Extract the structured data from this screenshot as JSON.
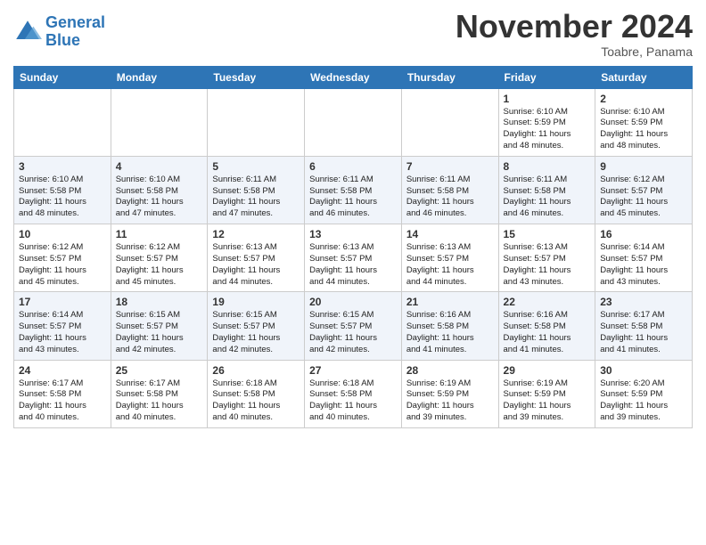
{
  "header": {
    "logo_line1": "General",
    "logo_line2": "Blue",
    "month_title": "November 2024",
    "location": "Toabre, Panama"
  },
  "weekdays": [
    "Sunday",
    "Monday",
    "Tuesday",
    "Wednesday",
    "Thursday",
    "Friday",
    "Saturday"
  ],
  "weeks": [
    [
      {
        "day": "",
        "info": ""
      },
      {
        "day": "",
        "info": ""
      },
      {
        "day": "",
        "info": ""
      },
      {
        "day": "",
        "info": ""
      },
      {
        "day": "",
        "info": ""
      },
      {
        "day": "1",
        "info": "Sunrise: 6:10 AM\nSunset: 5:59 PM\nDaylight: 11 hours\nand 48 minutes."
      },
      {
        "day": "2",
        "info": "Sunrise: 6:10 AM\nSunset: 5:59 PM\nDaylight: 11 hours\nand 48 minutes."
      }
    ],
    [
      {
        "day": "3",
        "info": "Sunrise: 6:10 AM\nSunset: 5:58 PM\nDaylight: 11 hours\nand 48 minutes."
      },
      {
        "day": "4",
        "info": "Sunrise: 6:10 AM\nSunset: 5:58 PM\nDaylight: 11 hours\nand 47 minutes."
      },
      {
        "day": "5",
        "info": "Sunrise: 6:11 AM\nSunset: 5:58 PM\nDaylight: 11 hours\nand 47 minutes."
      },
      {
        "day": "6",
        "info": "Sunrise: 6:11 AM\nSunset: 5:58 PM\nDaylight: 11 hours\nand 46 minutes."
      },
      {
        "day": "7",
        "info": "Sunrise: 6:11 AM\nSunset: 5:58 PM\nDaylight: 11 hours\nand 46 minutes."
      },
      {
        "day": "8",
        "info": "Sunrise: 6:11 AM\nSunset: 5:58 PM\nDaylight: 11 hours\nand 46 minutes."
      },
      {
        "day": "9",
        "info": "Sunrise: 6:12 AM\nSunset: 5:57 PM\nDaylight: 11 hours\nand 45 minutes."
      }
    ],
    [
      {
        "day": "10",
        "info": "Sunrise: 6:12 AM\nSunset: 5:57 PM\nDaylight: 11 hours\nand 45 minutes."
      },
      {
        "day": "11",
        "info": "Sunrise: 6:12 AM\nSunset: 5:57 PM\nDaylight: 11 hours\nand 45 minutes."
      },
      {
        "day": "12",
        "info": "Sunrise: 6:13 AM\nSunset: 5:57 PM\nDaylight: 11 hours\nand 44 minutes."
      },
      {
        "day": "13",
        "info": "Sunrise: 6:13 AM\nSunset: 5:57 PM\nDaylight: 11 hours\nand 44 minutes."
      },
      {
        "day": "14",
        "info": "Sunrise: 6:13 AM\nSunset: 5:57 PM\nDaylight: 11 hours\nand 44 minutes."
      },
      {
        "day": "15",
        "info": "Sunrise: 6:13 AM\nSunset: 5:57 PM\nDaylight: 11 hours\nand 43 minutes."
      },
      {
        "day": "16",
        "info": "Sunrise: 6:14 AM\nSunset: 5:57 PM\nDaylight: 11 hours\nand 43 minutes."
      }
    ],
    [
      {
        "day": "17",
        "info": "Sunrise: 6:14 AM\nSunset: 5:57 PM\nDaylight: 11 hours\nand 43 minutes."
      },
      {
        "day": "18",
        "info": "Sunrise: 6:15 AM\nSunset: 5:57 PM\nDaylight: 11 hours\nand 42 minutes."
      },
      {
        "day": "19",
        "info": "Sunrise: 6:15 AM\nSunset: 5:57 PM\nDaylight: 11 hours\nand 42 minutes."
      },
      {
        "day": "20",
        "info": "Sunrise: 6:15 AM\nSunset: 5:57 PM\nDaylight: 11 hours\nand 42 minutes."
      },
      {
        "day": "21",
        "info": "Sunrise: 6:16 AM\nSunset: 5:58 PM\nDaylight: 11 hours\nand 41 minutes."
      },
      {
        "day": "22",
        "info": "Sunrise: 6:16 AM\nSunset: 5:58 PM\nDaylight: 11 hours\nand 41 minutes."
      },
      {
        "day": "23",
        "info": "Sunrise: 6:17 AM\nSunset: 5:58 PM\nDaylight: 11 hours\nand 41 minutes."
      }
    ],
    [
      {
        "day": "24",
        "info": "Sunrise: 6:17 AM\nSunset: 5:58 PM\nDaylight: 11 hours\nand 40 minutes."
      },
      {
        "day": "25",
        "info": "Sunrise: 6:17 AM\nSunset: 5:58 PM\nDaylight: 11 hours\nand 40 minutes."
      },
      {
        "day": "26",
        "info": "Sunrise: 6:18 AM\nSunset: 5:58 PM\nDaylight: 11 hours\nand 40 minutes."
      },
      {
        "day": "27",
        "info": "Sunrise: 6:18 AM\nSunset: 5:58 PM\nDaylight: 11 hours\nand 40 minutes."
      },
      {
        "day": "28",
        "info": "Sunrise: 6:19 AM\nSunset: 5:59 PM\nDaylight: 11 hours\nand 39 minutes."
      },
      {
        "day": "29",
        "info": "Sunrise: 6:19 AM\nSunset: 5:59 PM\nDaylight: 11 hours\nand 39 minutes."
      },
      {
        "day": "30",
        "info": "Sunrise: 6:20 AM\nSunset: 5:59 PM\nDaylight: 11 hours\nand 39 minutes."
      }
    ]
  ]
}
